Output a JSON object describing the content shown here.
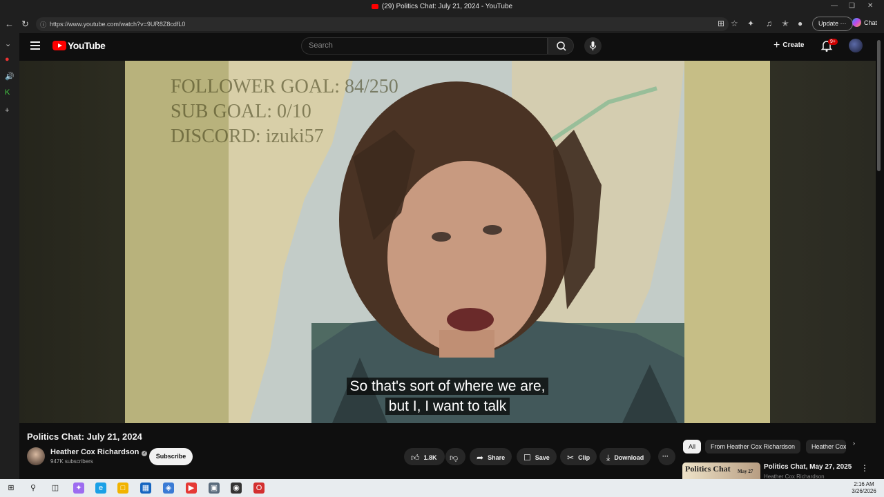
{
  "window": {
    "title": "(29) Politics Chat: July 21, 2024 - YouTube"
  },
  "browser": {
    "url": "https://www.youtube.com/watch?v=9UR8Z8cdfL0",
    "update_label": "Update",
    "chat_label": "Chat"
  },
  "youtube": {
    "logo_text": "YouTube",
    "search_placeholder": "Search",
    "create_label": "Create",
    "notification_count": "9+"
  },
  "video": {
    "overlay_lines": [
      "FOLLOWER GOAL: 84/250",
      "SUB GOAL: 0/10",
      "DISCORD: izuki57"
    ],
    "caption_line1": "So that's sort of where we are,",
    "caption_line2": "but I, I want to talk",
    "title": "Politics Chat: July 21, 2024"
  },
  "channel": {
    "name": "Heather Cox Richardson",
    "subscribers": "947K subscribers",
    "subscribe_label": "Subscribe"
  },
  "actions": {
    "like_count": "1.8K",
    "share_label": "Share",
    "save_label": "Save",
    "clip_label": "Clip",
    "download_label": "Download"
  },
  "chips": [
    "All",
    "From Heather Cox Richardson",
    "Heather Cox Richardson"
  ],
  "recommendation": {
    "thumb_text": "Politics Chat",
    "thumb_badge": "May 27",
    "title": "Politics Chat, May 27, 2025",
    "channel": "Heather Cox Richardson"
  },
  "taskbar": {
    "time": "2:16 AM",
    "date": "3/26/2026"
  },
  "colors": {
    "youtube_red": "#ff0000",
    "background": "#0f0f0f",
    "chip_bg": "#272727"
  }
}
